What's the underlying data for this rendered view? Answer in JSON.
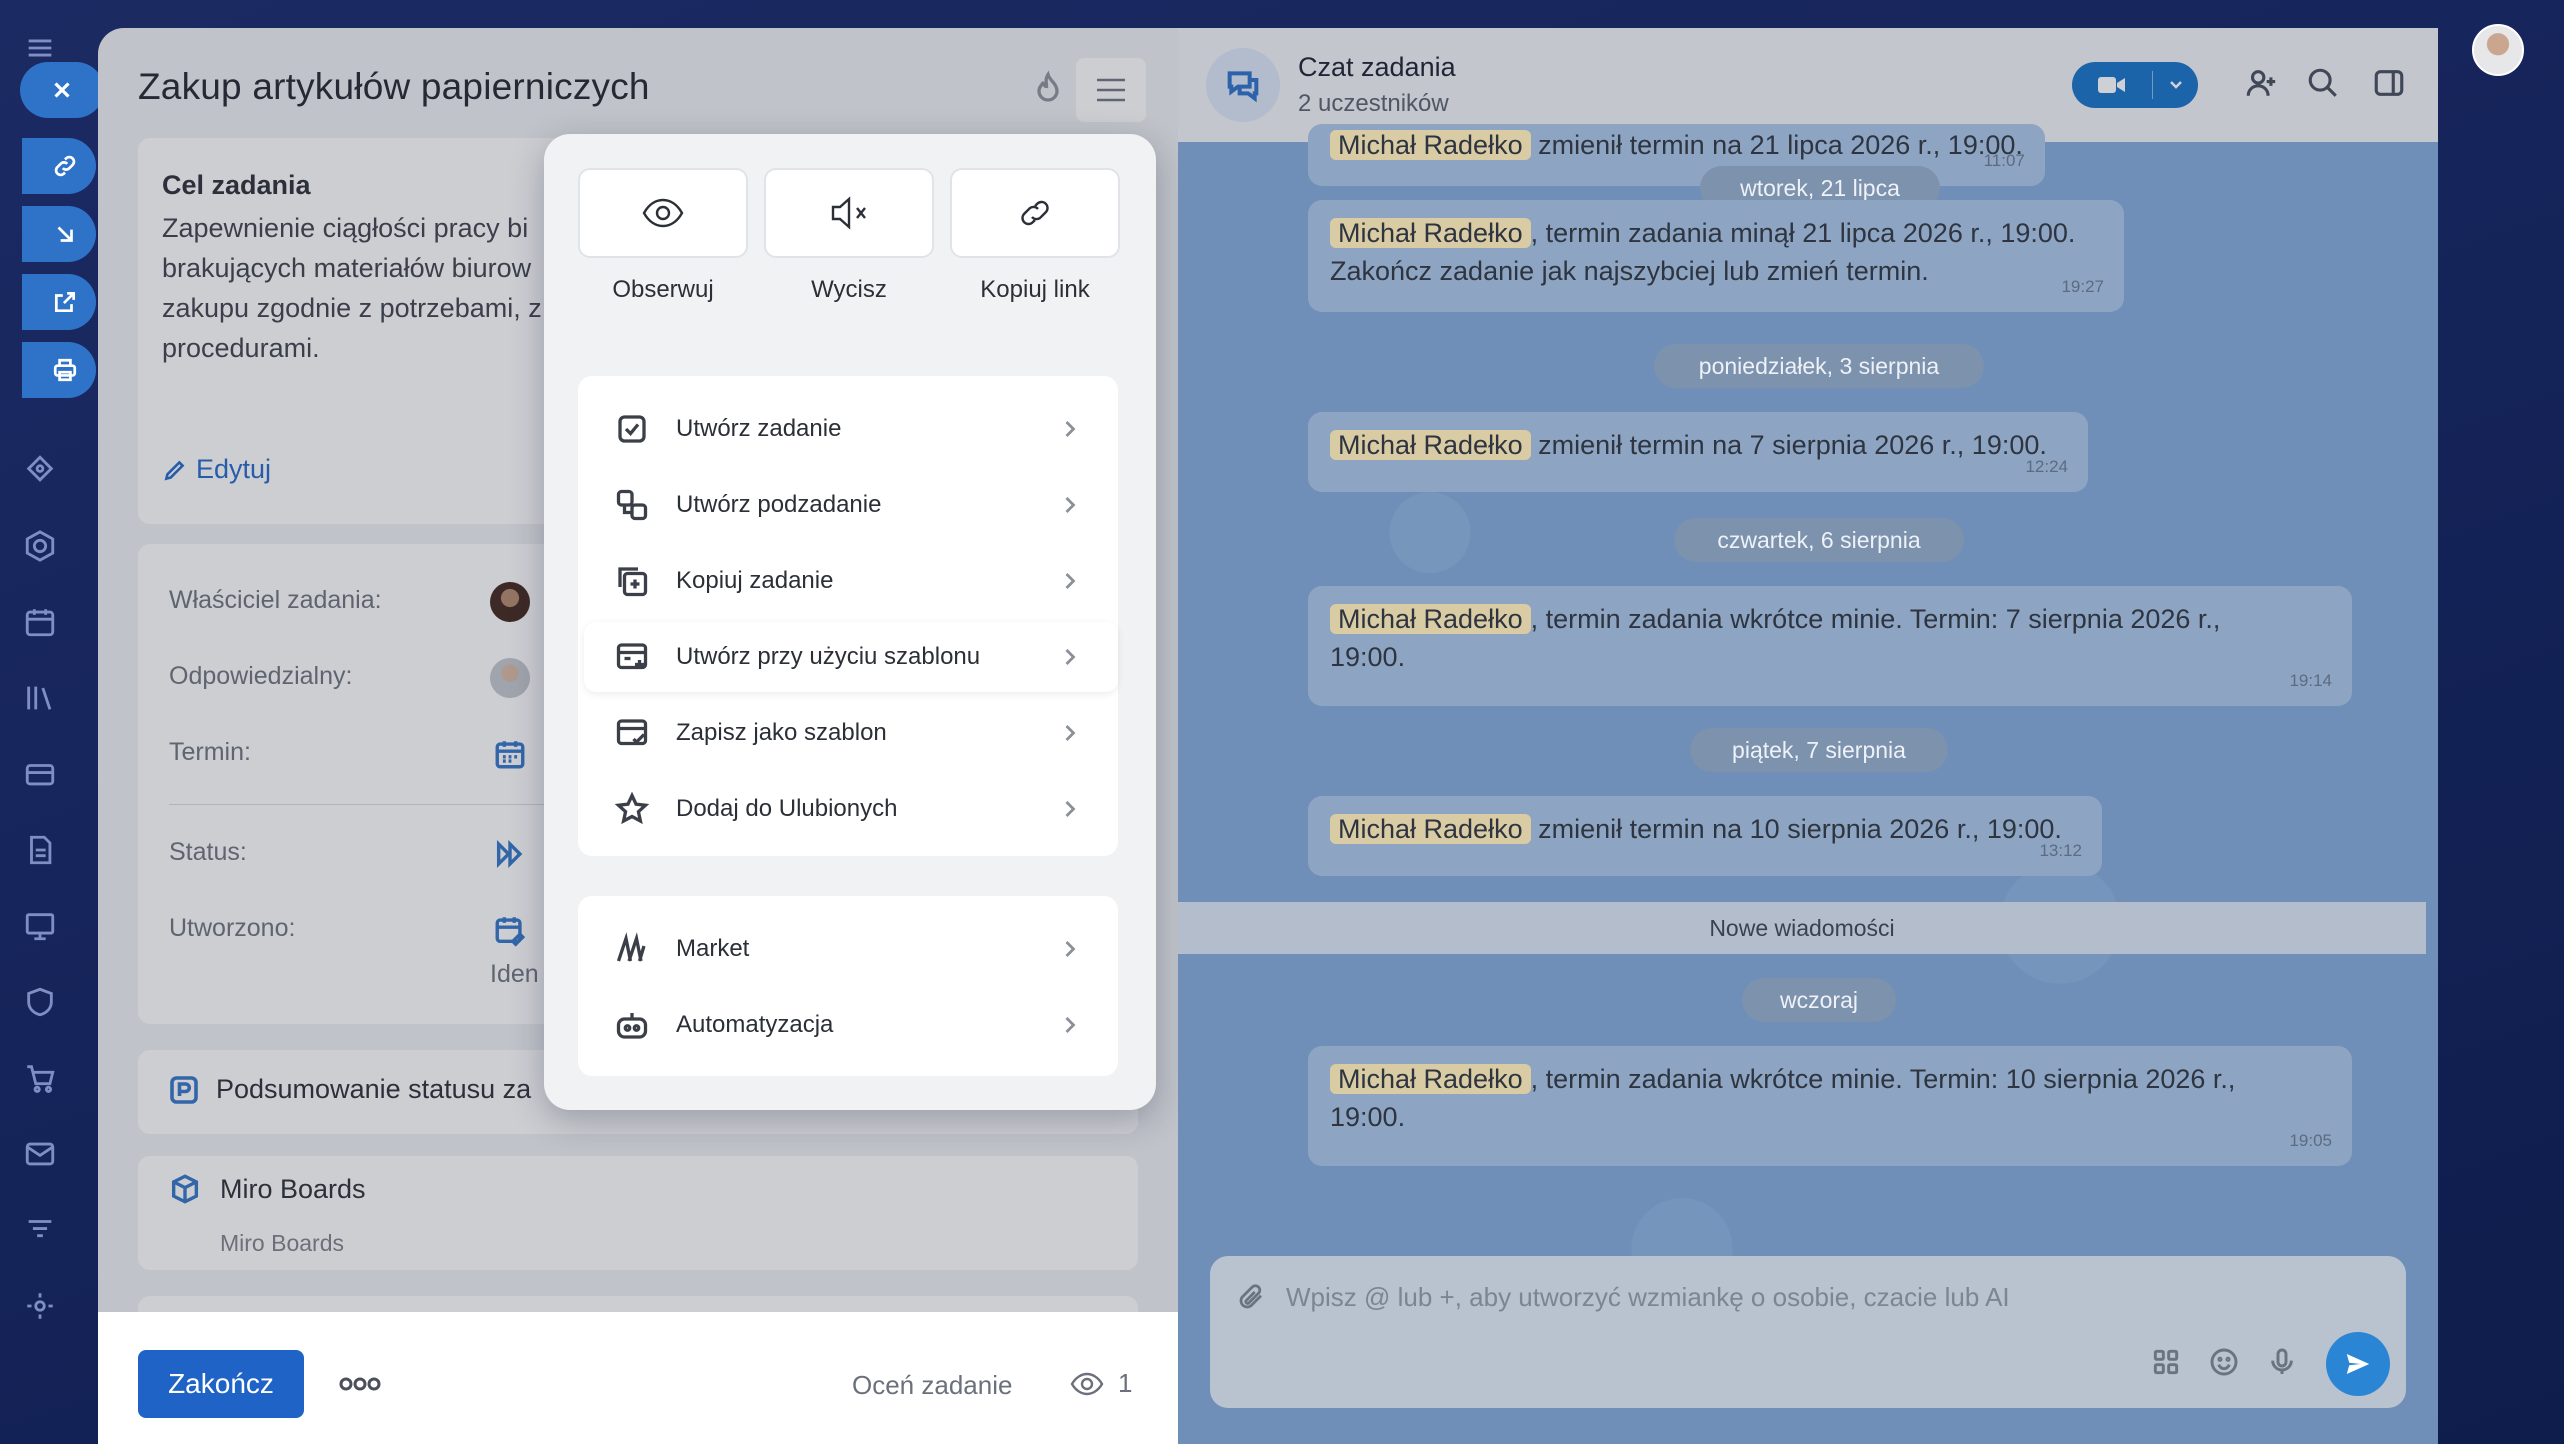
{
  "task": {
    "title": "Zakup artykułów papierniczych",
    "goal_title": "Cel zadania",
    "goal_text": "Zapewnienie ciągłości pracy bi\nbrakujących materiałów biurow\nzakupu zgodnie z potrzebami, z\nprocedurami.",
    "edit_label": "Edytuj",
    "props": {
      "owner_label": "Właściciel zadania:",
      "responsible_label": "Odpowiedzialny:",
      "deadline_label": "Termin:",
      "status_label": "Status:",
      "created_label": "Utworzono:",
      "ident_text": "Iden"
    },
    "status_summary": "Podsumowanie statusu za",
    "miro_title": "Miro Boards",
    "miro_sub": "Miro Boards",
    "finish_label": "Zakończ",
    "rate_label": "Oceń zadanie",
    "views_count": "1"
  },
  "dropdown": {
    "actions": [
      {
        "label": "Obserwuj",
        "icon": "eye-icon"
      },
      {
        "label": "Wycisz",
        "icon": "mute-icon"
      },
      {
        "label": "Kopiuj link",
        "icon": "link-icon"
      }
    ],
    "items": [
      {
        "label": "Utwórz zadanie",
        "icon": "checkbox-icon"
      },
      {
        "label": "Utwórz podzadanie",
        "icon": "subtask-icon"
      },
      {
        "label": "Kopiuj zadanie",
        "icon": "copy-icon"
      },
      {
        "label": "Utwórz przy użyciu szablonu",
        "icon": "template-add-icon",
        "active": true
      },
      {
        "label": "Zapisz jako szablon",
        "icon": "template-save-icon"
      },
      {
        "label": "Dodaj do Ulubionych",
        "icon": "star-icon"
      }
    ],
    "items2": [
      {
        "label": "Market",
        "icon": "market-icon"
      },
      {
        "label": "Automatyzacja",
        "icon": "robot-icon"
      }
    ]
  },
  "chat": {
    "title": "Czat zadania",
    "subtitle": "2 uczestników",
    "new_messages": "Nowe wiadomości",
    "composer_placeholder": "Wpisz @ lub +, aby utworzyć wzmiankę o osobie, czacie lub AI",
    "top_partial": {
      "name": "Michał Radełko",
      "text": " zmienił termin na 21 lipca 2026 r., 19:00.",
      "time": "11:07"
    },
    "dates": [
      "wtorek, 21 lipca",
      "poniedziałek, 3 sierpnia",
      "czwartek, 6 sierpnia",
      "piątek, 7 sierpnia",
      "wczoraj"
    ],
    "messages": [
      {
        "name": "Michał Radełko",
        "text": ", termin zadania minął 21 lipca 2026 r., 19:00.",
        "text2": "Zakończ zadanie jak najszybciej lub zmień termin.",
        "time": "19:27"
      },
      {
        "name": "Michał Radełko",
        "text": " zmienił termin na 7 sierpnia 2026 r., 19:00.",
        "text2": "",
        "time": "12:24"
      },
      {
        "name": "Michał Radełko",
        "text": ", termin zadania wkrótce minie. Termin: 7 sierpnia 2026 r.,",
        "text2": "19:00.",
        "time": "19:14"
      },
      {
        "name": "Michał Radełko",
        "text": " zmienił termin na 10 sierpnia 2026 r., 19:00.",
        "text2": "",
        "time": "13:12"
      },
      {
        "name": "Michał Radełko",
        "text": ", termin zadania wkrótce minie. Termin: 10 sierpnia 2026 r.,",
        "text2": "19:00.",
        "time": "19:05"
      }
    ]
  },
  "colors": {
    "accent": "#1f63c6",
    "chat_bg": "#6f8fb8",
    "name_chip": "#d9cca4"
  }
}
